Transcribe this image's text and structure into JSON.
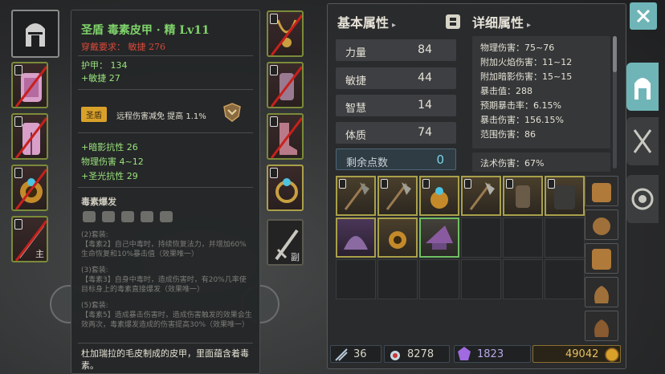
{
  "tooltip": {
    "title": "圣盾 毒素皮甲 · 精 Lv11",
    "requirement": "穿戴要求： 敏捷 276",
    "armor": "护甲： 134",
    "agility": "+敏捷 27",
    "badge": "圣盾",
    "bonus": "远程伤害减免 提高 1.1%",
    "stats": [
      "+暗影抗性 26",
      "物理伤害 4~12",
      "+圣光抗性 29"
    ],
    "set_title": "毒素爆发",
    "set2_head": "(2)套装:",
    "set2_text": "【毒素2】自己中毒时，持续恢复法力，并增加60%生命恢复和10%暴击值（效果唯一）",
    "set3_head": "(3)套装:",
    "set3_text": "【毒素3】自身中毒时，造成伤害时，有20%几率使目标身上的毒素直接爆发（效果唯一）",
    "set5_head": "(5)套装:",
    "set5_text": "【毒素5】造成暴击伤害时，造成伤害触发的效果会生效两次，毒素爆发造成的伤害提高30%（效果唯一）",
    "description": "杜加瑞拉的毛皮制成的皮甲，里面蕴含着毒素。"
  },
  "slots": {
    "weapon_label": "主",
    "skill_label": "副"
  },
  "basic": {
    "header": "基本属性",
    "arrow": "▸",
    "attributes": [
      {
        "label": "力量",
        "value": "84"
      },
      {
        "label": "敏捷",
        "value": "44"
      },
      {
        "label": "智慧",
        "value": "14"
      },
      {
        "label": "体质",
        "value": "74"
      }
    ],
    "points_label": "剩余点数",
    "points_value": "0"
  },
  "detail": {
    "header": "详细属性",
    "arrow": "▸",
    "lines": [
      "物理伤害：75~76",
      "附加火焰伤害：11~12",
      "附加暗影伤害：15~15",
      "暴击值：288",
      "预期暴击率：6.15%",
      "暴击伤害：156.15%",
      "范围伤害：86"
    ],
    "magic": "法术伤害：67%"
  },
  "footer": {
    "arrows": "36",
    "potions": "8278",
    "gems": "1823",
    "gold": "49042"
  },
  "colors": {
    "close_button": "#6fb5b8",
    "active_tab": "#6fb5b8",
    "title_green": "#7fd36a",
    "requirement_red": "#d94a3a"
  }
}
